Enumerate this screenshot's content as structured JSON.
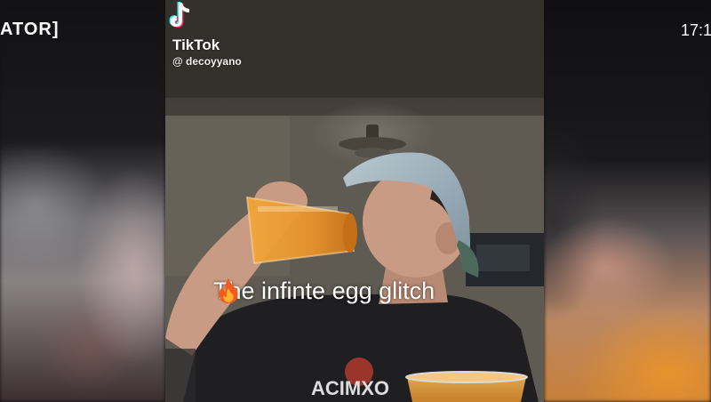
{
  "channel": {
    "brand_fragment": "ATOR]",
    "time": "17:1"
  },
  "tiktok": {
    "wordmark": "TikTok",
    "handle": "@ decoyyano",
    "logo_icon": "tiktok-note-icon"
  },
  "video": {
    "caption": "The infinte egg glitch",
    "caption_icon": "fire-icon",
    "shirt_text": "ACIMXO"
  },
  "colors": {
    "juice": "#e8952c",
    "cap": "#8fa6b3",
    "shirt": "#1f1f22",
    "skin": "#c99b84"
  }
}
